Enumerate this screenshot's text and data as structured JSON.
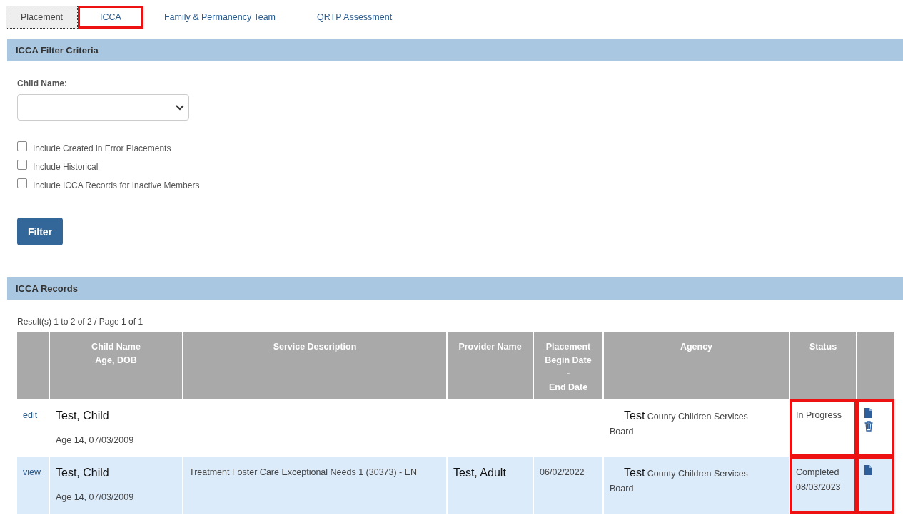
{
  "tabs": [
    {
      "label": "Placement",
      "selected": true,
      "highlighted": false
    },
    {
      "label": "ICCA",
      "selected": false,
      "highlighted": true
    },
    {
      "label": "Family & Permanency Team",
      "selected": false,
      "highlighted": false
    },
    {
      "label": "QRTP Assessment",
      "selected": false,
      "highlighted": false
    }
  ],
  "filter_section": {
    "title": "ICCA Filter Criteria",
    "child_name_label": "Child Name:",
    "checkboxes": [
      {
        "label": "Include Created in Error Placements",
        "checked": false
      },
      {
        "label": "Include Historical",
        "checked": false
      },
      {
        "label": "Include ICCA Records for Inactive Members",
        "checked": false
      }
    ],
    "button": "Filter"
  },
  "records_section": {
    "title": "ICCA Records",
    "results": "Result(s) 1 to 2 of 2 / Page 1 of 1",
    "columns": [
      {
        "kind": "blank"
      },
      {
        "kind": "text",
        "label": "Child Name\nAge, DOB"
      },
      {
        "kind": "text",
        "label": "Service Description"
      },
      {
        "kind": "text",
        "label": "Provider Name"
      },
      {
        "kind": "text",
        "label": "Placement\nBegin Date\n-\nEnd Date"
      },
      {
        "kind": "text",
        "label": "Agency"
      },
      {
        "kind": "text",
        "label": "Status"
      },
      {
        "kind": "blank"
      }
    ],
    "rows": [
      {
        "action": "edit",
        "child": "Test, Child",
        "age_dob": "Age 14, 07/03/2009",
        "agency_lead": "Test",
        "agency": "County Children Services Board",
        "status": "In Progress",
        "status_highlighted": true,
        "icons": [
          {
            "kind": "document"
          },
          {
            "kind": "trash"
          }
        ],
        "selected": false
      },
      {
        "action": "view",
        "child": "Test, Child",
        "age_dob": "Age 14, 07/03/2009",
        "service": "Treatment Foster Care Exceptional Needs 1 (30373) - EN",
        "provider": "Test, Adult",
        "begin_date": "06/02/2022",
        "agency_lead": "Test",
        "agency": "County Children Services Board",
        "status": "Completed 08/03/2023",
        "status_highlighted": true,
        "icons": [
          {
            "kind": "document"
          }
        ],
        "selected": true
      }
    ]
  }
}
